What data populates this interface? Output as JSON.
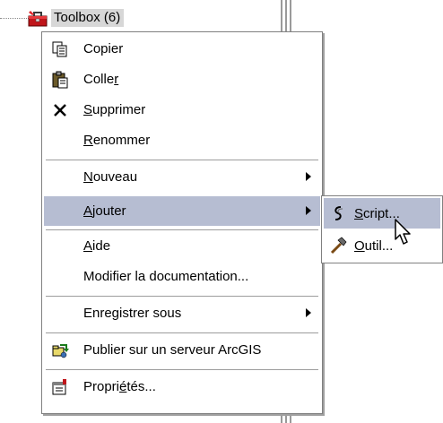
{
  "tree": {
    "node_label": "Toolbox (6)",
    "node_icon": "toolbox-icon"
  },
  "menu": {
    "items": [
      {
        "pre": "",
        "ul": "",
        "post": "Copier",
        "icon": "copy-icon"
      },
      {
        "pre": "Colle",
        "ul": "r",
        "post": "",
        "icon": "paste-icon"
      },
      {
        "pre": "",
        "ul": "S",
        "post": "upprimer",
        "icon": "delete-icon"
      },
      {
        "pre": "",
        "ul": "R",
        "post": "enommer",
        "icon": ""
      },
      {
        "pre": "",
        "ul": "N",
        "post": "ouveau",
        "icon": "",
        "submenu": true
      },
      {
        "pre": "",
        "ul": "A",
        "post": "jouter",
        "icon": "",
        "submenu": true,
        "highlighted": true
      },
      {
        "pre": "",
        "ul": "A",
        "post": "ide",
        "icon": ""
      },
      {
        "pre": "",
        "ul": "",
        "post": "Modifier la documentation...",
        "icon": ""
      },
      {
        "pre": "",
        "ul": "",
        "post": "Enregistrer sous",
        "icon": "",
        "submenu": true
      },
      {
        "pre": "",
        "ul": "",
        "post": "Publier sur un serveur ArcGIS",
        "icon": "publish-icon"
      },
      {
        "pre": "Propri",
        "ul": "é",
        "post": "tés...",
        "icon": "properties-icon"
      }
    ]
  },
  "submenu": {
    "items": [
      {
        "pre": "",
        "ul": "S",
        "post": "cript...",
        "icon": "script-icon",
        "highlighted": true
      },
      {
        "pre": "",
        "ul": "O",
        "post": "util...",
        "icon": "hammer-icon"
      }
    ]
  },
  "colors": {
    "highlight": "#b6bdd2",
    "tree_selection": "#d7d7d7",
    "menu_border": "#808080"
  }
}
